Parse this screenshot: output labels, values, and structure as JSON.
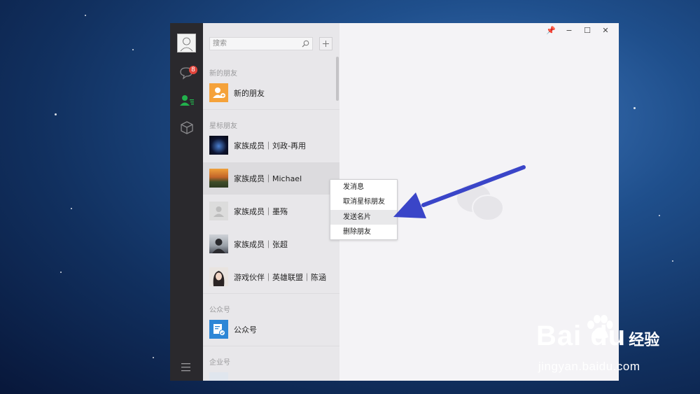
{
  "colors": {
    "accent_green": "#22b14c",
    "badge_red": "#e2453c",
    "arrow_blue": "#3a45c8",
    "sidebar_bg": "#2a292d"
  },
  "iconbar": {
    "chat_badge": "8",
    "icons": [
      "avatar",
      "chat-icon",
      "contacts-icon",
      "box-icon",
      "menu-icon"
    ]
  },
  "search": {
    "placeholder": "搜索"
  },
  "sections": {
    "new_friends": "新的朋友",
    "starred": "星标朋友",
    "official": "公众号",
    "enterprise": "企业号"
  },
  "contacts": [
    {
      "name": "新的朋友"
    },
    {
      "name": "家族成员｜刘政-再用"
    },
    {
      "name": "家族成员｜Michael"
    },
    {
      "name": "家族成员｜墨殇"
    },
    {
      "name": "家族成员｜张超"
    },
    {
      "name": "游戏伙伴｜英雄联盟｜陈涵"
    },
    {
      "name": "公众号"
    }
  ],
  "context_menu": [
    "发消息",
    "取消星标朋友",
    "发送名片",
    "删除朋友"
  ],
  "window_controls": [
    "📌",
    "−",
    "☐",
    "✕"
  ],
  "watermark": {
    "brand": "Bai du",
    "suffix": "经验",
    "url": "jingyan.baidu.com"
  }
}
